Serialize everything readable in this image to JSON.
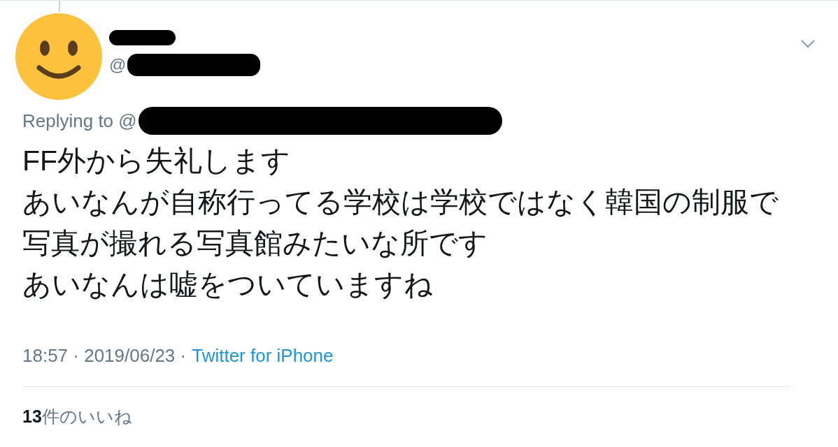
{
  "author": {
    "handle_prefix": "@"
  },
  "reply": {
    "label": "Replying to @"
  },
  "text_lines": [
    "FF外から失礼します",
    "あいなんが自称行ってる学校は学校ではなく韓国の制服で",
    "写真が撮れる写真館みたいな所です",
    "あいなんは嘘をついていますね"
  ],
  "meta": {
    "time": "18:57 · 2019/06/23 · ",
    "source": "Twitter for iPhone"
  },
  "likes": {
    "count": "13",
    "label": "件のいいね"
  }
}
